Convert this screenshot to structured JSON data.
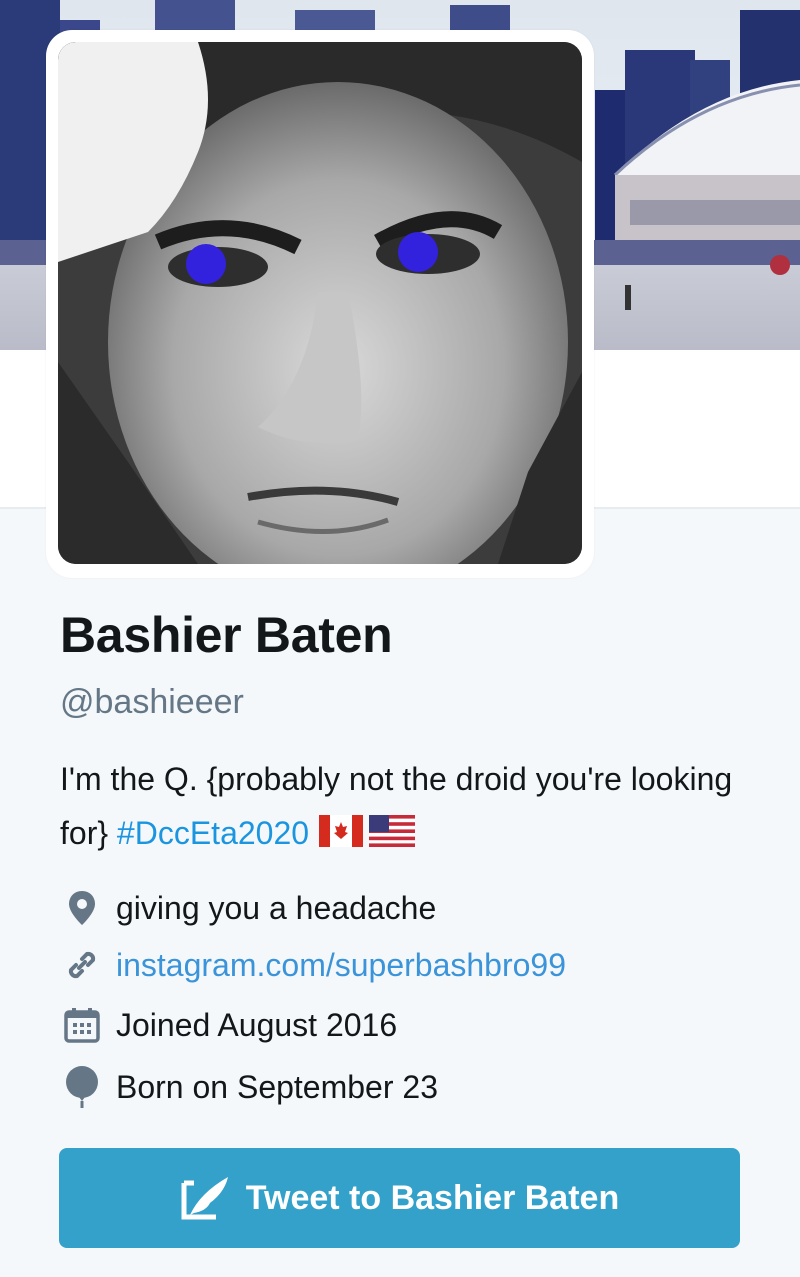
{
  "profile": {
    "name": "Bashier Baten",
    "handle": "@bashieeer",
    "bio_text": "I'm the Q. {probably not the droid you're looking for}",
    "bio_hashtag": "#DccEta2020",
    "bio_flags": [
      "canada-flag",
      "usa-flag"
    ]
  },
  "meta": {
    "location": "giving you a headache",
    "website": "instagram.com/superbashbro99",
    "joined": "Joined August 2016",
    "born": "Born on September 23"
  },
  "actions": {
    "tweet_label": "Tweet to Bashier Baten"
  },
  "icons": {
    "location": "map-pin-icon",
    "website": "link-icon",
    "joined": "calendar-icon",
    "born": "balloon-icon",
    "tweet": "compose-quill-icon"
  },
  "colors": {
    "link": "#1b95e0",
    "button": "#33a1c9",
    "secondary_text": "#657786",
    "primary_text": "#14171a"
  }
}
